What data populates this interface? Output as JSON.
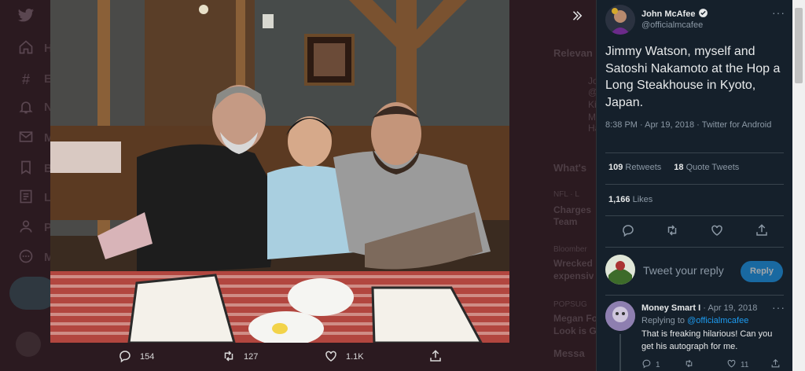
{
  "background": {
    "nav_letters": [
      "H",
      "E",
      "N",
      "M",
      "B",
      "L",
      "P",
      "M"
    ],
    "right_snippets": [
      "Relevan",
      "Jo",
      "@",
      "Ki",
      "M",
      "Ha",
      "What's",
      "NFL · L",
      "Charges",
      "Team",
      "Bloomber",
      "Wrecked",
      "expensiv",
      "POPSUG",
      "Megan Fo",
      "Look is G",
      "Messa"
    ]
  },
  "photo_actions": {
    "reply_count": "154",
    "retweet_count": "127",
    "like_count": "1.1K"
  },
  "tweet": {
    "author_name": "John McAfee",
    "author_handle": "@officialmcafee",
    "more": "···",
    "text": "Jimmy Watson, myself and Satoshi Nakamoto at the Hop a Long Steakhouse in Kyoto, Japan.",
    "timestamp": "8:38 PM · Apr 19, 2018 · Twitter for Android",
    "retweets_count": "109",
    "retweets_label": "Retweets",
    "quote_count": "18",
    "quote_label": "Quote Tweets",
    "likes_count": "1,166",
    "likes_label": "Likes"
  },
  "reply_box": {
    "placeholder": "Tweet your reply",
    "button": "Reply"
  },
  "reply": {
    "name": "Money Smart I",
    "date": "· Apr 19, 2018",
    "more": "···",
    "replying_prefix": "Replying to ",
    "replying_to": "@officialmcafee",
    "text": "That is freaking hilarious! Can you get his autograph for me.",
    "reply_count": "1",
    "like_count": "11"
  },
  "icons": [
    "twitter-icon",
    "home-icon",
    "explore-icon",
    "notifications-icon",
    "messages-icon",
    "bookmarks-icon",
    "lists-icon",
    "profile-icon",
    "more-icon",
    "expand-icon",
    "verified-icon",
    "reply-icon",
    "retweet-icon",
    "like-icon",
    "share-icon"
  ],
  "colors": {
    "accent": "#1d9bf0",
    "panel_bg": "#15202b",
    "muted_text": "#8b98a5"
  }
}
